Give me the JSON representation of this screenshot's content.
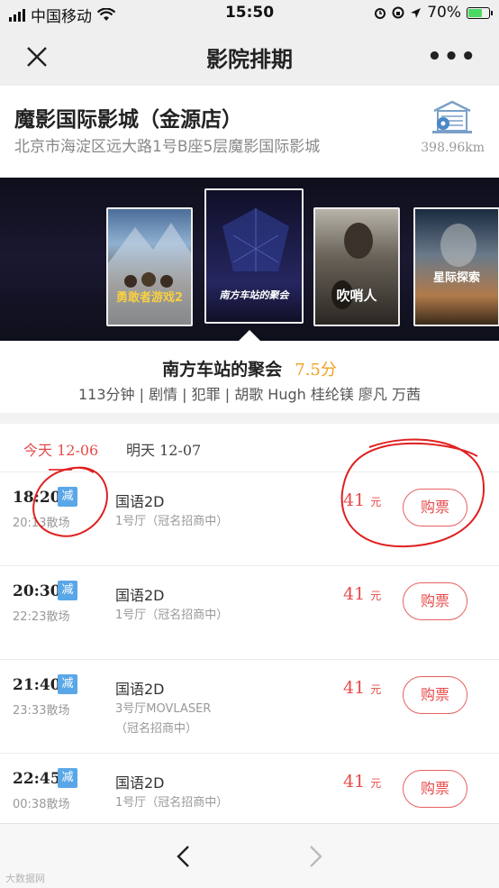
{
  "status_bar": {
    "carrier": "中国移动",
    "time": "15:50",
    "battery": "70%"
  },
  "nav": {
    "title": "影院排期"
  },
  "cinema": {
    "name": "魔影国际影城（金源店）",
    "address": "北京市海淀区远大路1号B座5层魔影国际影城",
    "distance": "398.96km"
  },
  "posters": [
    {
      "title": "勇敢者游戏2",
      "selected": false
    },
    {
      "title": "南方车站的聚会",
      "selected": true
    },
    {
      "title": "吹哨人",
      "selected": false
    },
    {
      "title": "星际探索",
      "selected": false
    }
  ],
  "movie": {
    "title": "南方车站的聚会",
    "score": "7.5分",
    "meta": "113分钟 | 剧情 | 犯罪 | 胡歌 Hugh 桂纶镁 廖凡 万茜"
  },
  "date_tabs": [
    {
      "label": "今天 12-06",
      "active": true
    },
    {
      "label": "明天 12-07",
      "active": false
    }
  ],
  "showtimes": [
    {
      "start": "18:20",
      "tag": "减",
      "end": "20:13散场",
      "language": "国语2D",
      "hall": "1号厅（冠名招商中）",
      "price": "41",
      "unit": "元",
      "buy_label": "购票"
    },
    {
      "start": "20:30",
      "tag": "减",
      "end": "22:23散场",
      "language": "国语2D",
      "hall": "1号厅（冠名招商中）",
      "price": "41",
      "unit": "元",
      "buy_label": "购票"
    },
    {
      "start": "21:40",
      "tag": "减",
      "end": "23:33散场",
      "language": "国语2D",
      "hall": "3号厅MOVLASER（冠名招商中）",
      "price": "41",
      "unit": "元",
      "buy_label": "购票"
    },
    {
      "start": "22:45",
      "tag": "减",
      "end": "00:38散场",
      "language": "国语2D",
      "hall": "1号厅（冠名招商中）",
      "price": "41",
      "unit": "元",
      "buy_label": "购票"
    }
  ],
  "watermark": "大数据网",
  "colors": {
    "accent": "#e84a4a",
    "tag": "#5aa7e8",
    "score": "#f0a020",
    "annotation": "#e02020"
  }
}
